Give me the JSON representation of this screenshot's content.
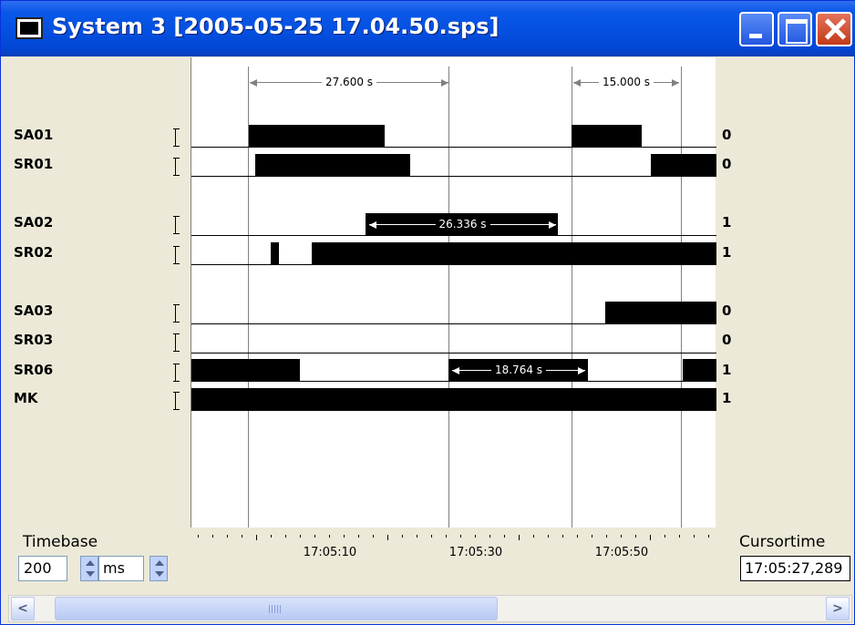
{
  "window": {
    "title": "System 3 [2005-05-25 17.04.50.sps]"
  },
  "signals": [
    {
      "name": "SA01",
      "value": "0"
    },
    {
      "name": "SR01",
      "value": "0"
    },
    {
      "name": "SA02",
      "value": "1"
    },
    {
      "name": "SR02",
      "value": "1"
    },
    {
      "name": "SA03",
      "value": "0"
    },
    {
      "name": "SR03",
      "value": "0"
    },
    {
      "name": "SR06",
      "value": "1"
    },
    {
      "name": "MK",
      "value": "1"
    }
  ],
  "measurements": [
    {
      "label": "27.600 s"
    },
    {
      "label": "15.000 s"
    },
    {
      "label": "26.336 s"
    },
    {
      "label": "18.764 s"
    }
  ],
  "axis": {
    "tick_labels": [
      "17:05:10",
      "17:05:30",
      "17:05:50"
    ]
  },
  "controls": {
    "timebase_label": "Timebase",
    "timebase_value": "200",
    "unit_value": "ms",
    "cursortime_label": "Cursortime",
    "cursortime_value": "17:05:27,289"
  },
  "scrollbar": {
    "left_glyph": "<",
    "right_glyph": ">"
  },
  "colors": {
    "titlebar": "#0450e0",
    "trace": "#000000",
    "background": "#ece9d8"
  }
}
